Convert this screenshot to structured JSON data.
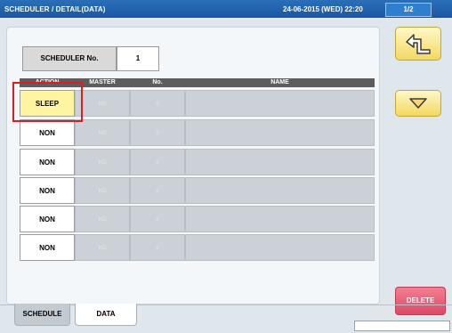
{
  "header": {
    "title": "SCHEDULER / DETAIL(DATA)",
    "datetime": "24-06-2015 (WED)  22:20",
    "page": "1/2"
  },
  "scheduler": {
    "label": "SCHEDULER No.",
    "value": "1"
  },
  "table": {
    "headers": [
      "ACTION",
      "MASTER",
      "No.",
      "NAME"
    ],
    "rows": [
      {
        "action": "SLEEP",
        "master": "NO",
        "no": "0",
        "name": ""
      },
      {
        "action": "NON",
        "master": "NO",
        "no": "0",
        "name": ""
      },
      {
        "action": "NON",
        "master": "NO",
        "no": "0",
        "name": ""
      },
      {
        "action": "NON",
        "master": "NO",
        "no": "0",
        "name": ""
      },
      {
        "action": "NON",
        "master": "NO",
        "no": "0",
        "name": ""
      },
      {
        "action": "NON",
        "master": "NO",
        "no": "0",
        "name": ""
      }
    ],
    "selected_row": 0
  },
  "buttons": {
    "back_icon": "return-arrow-icon",
    "down_icon": "down-triangle-icon",
    "delete_label": "DELETE"
  },
  "tabs": [
    {
      "label": "SCHEDULE",
      "active": false
    },
    {
      "label": "DATA",
      "active": true
    }
  ],
  "colors": {
    "header": "#1b56a3",
    "selected": "#fff4a0",
    "highlight": "#e01b22",
    "delete": "#de4865",
    "action_button": "#f3d95f"
  }
}
